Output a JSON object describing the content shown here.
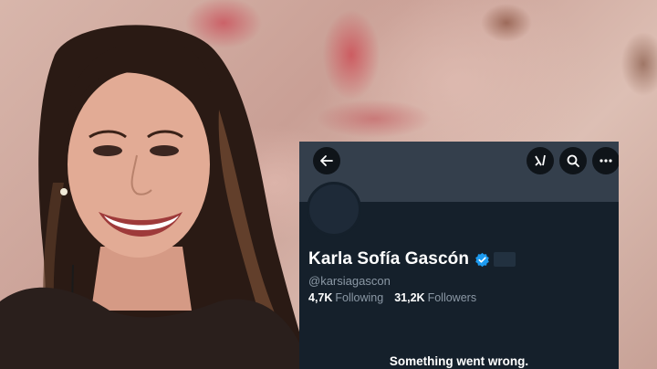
{
  "profile": {
    "display_name": "Karla Sofía Gascón",
    "handle": "@karsiagascon",
    "following_count": "4,7K",
    "following_label": "Following",
    "followers_count": "31,2K",
    "followers_label": "Followers",
    "verified": true
  },
  "error": {
    "message": "Something went wrong."
  },
  "toolbar": {
    "icons": [
      "back-arrow-icon",
      "grok-icon",
      "search-icon",
      "more-icon"
    ]
  },
  "colors": {
    "panel_background": "#15202b",
    "banner": "#343f4c",
    "verified_badge": "#1d9bf0",
    "secondary_text": "#8b98a5"
  }
}
